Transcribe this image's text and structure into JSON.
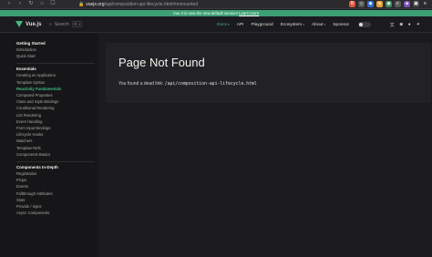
{
  "browser": {
    "url_host": "vuejs.org",
    "url_path": "/api/composition-api-lifecycle.html#onmounted"
  },
  "banner": {
    "text": "Vue 3 is now the new default version! ",
    "link": "Learn more"
  },
  "header": {
    "logo_text": "Vue.js",
    "search_label": "Search",
    "search_kbd": "⌘ K",
    "menu": [
      {
        "label": "Docs",
        "caret": "▾"
      },
      {
        "label": "API"
      },
      {
        "label": "Playground"
      },
      {
        "label": "Ecosystem",
        "caret": "▾"
      },
      {
        "label": "About",
        "caret": "▾"
      },
      {
        "label": "Sponsor"
      }
    ]
  },
  "sidebar": {
    "groups": [
      {
        "title": "Getting Started",
        "items": [
          "Introduction",
          "Quick Start"
        ]
      },
      {
        "title": "Essentials",
        "items": [
          "Creating an Application",
          "Template Syntax",
          "Reactivity Fundamentals",
          "Computed Properties",
          "Class and Style Bindings",
          "Conditional Rendering",
          "List Rendering",
          "Event Handling",
          "Form Input Bindings",
          "Lifecycle Hooks",
          "Watchers",
          "Template Refs",
          "Components Basics"
        ]
      },
      {
        "title": "Components In-Depth",
        "items": [
          "Registration",
          "Props",
          "Events",
          "Fallthrough Attributes",
          "Slots",
          "Provide / inject",
          "Async Components"
        ]
      }
    ],
    "active_item": "Reactivity Fundamentals"
  },
  "content": {
    "title": "Page Not Found",
    "text_prefix": "You found a dead link: ",
    "dead_link": "/api/composition-api-lifecycle.html"
  },
  "colors": {
    "accent": "#42b883",
    "banner": "#3f9f74",
    "background": "#1b1b1f",
    "sidebar": "#161618"
  }
}
